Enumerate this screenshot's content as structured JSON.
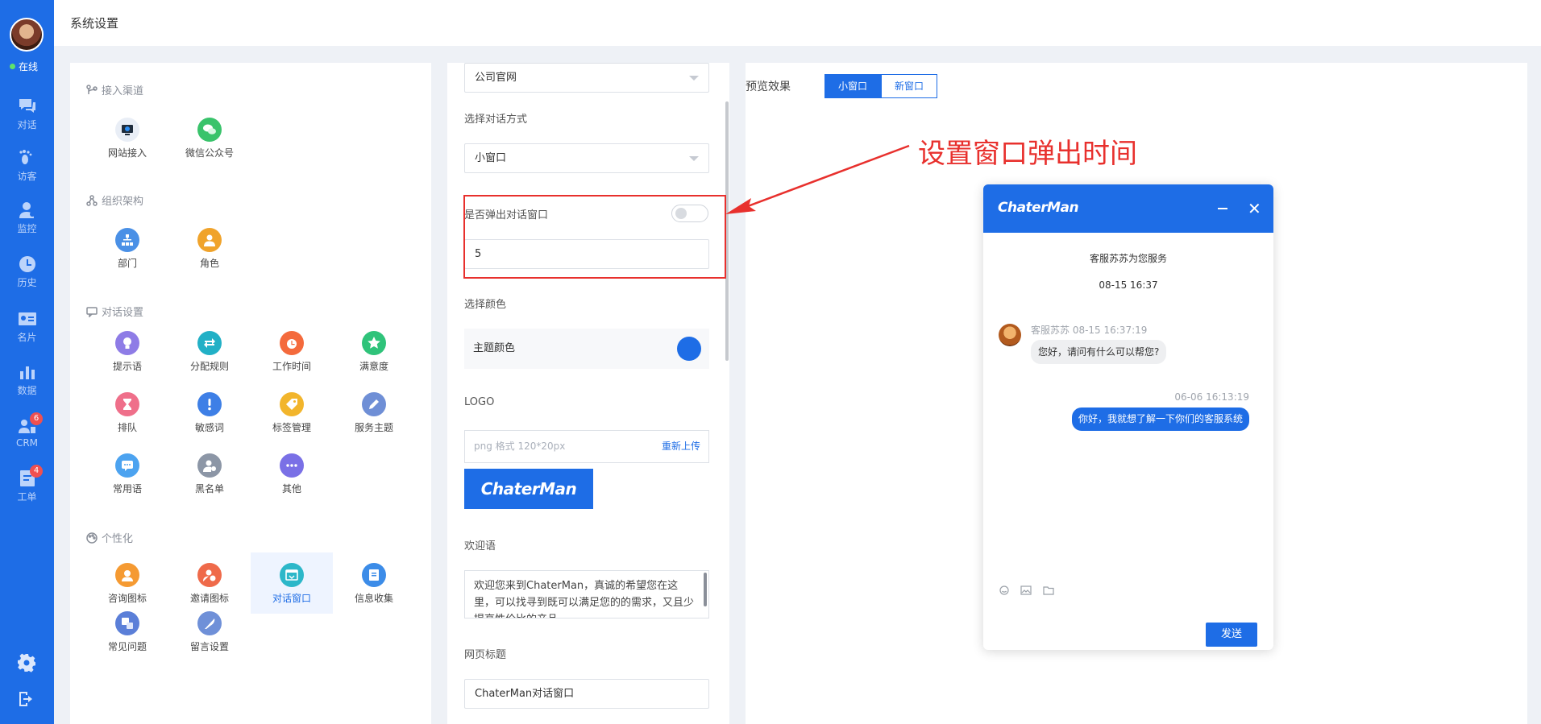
{
  "rail": {
    "status": "在线",
    "items": [
      {
        "label": "对话",
        "icon": "chat-icon"
      },
      {
        "label": "访客",
        "icon": "footprint-icon"
      },
      {
        "label": "监控",
        "icon": "monitor-user-icon"
      },
      {
        "label": "历史",
        "icon": "clock-icon"
      },
      {
        "label": "名片",
        "icon": "card-icon"
      },
      {
        "label": "数据",
        "icon": "bar-chart-icon"
      },
      {
        "label": "CRM",
        "icon": "crm-icon",
        "badge": "6"
      },
      {
        "label": "工单",
        "icon": "ticket-icon",
        "badge": "4"
      }
    ]
  },
  "header": {
    "title": "系统设置"
  },
  "menu": {
    "sections": [
      {
        "title": "接入渠道",
        "items": [
          "网站接入",
          "微信公众号"
        ]
      },
      {
        "title": "组织架构",
        "items": [
          "部门",
          "角色"
        ]
      },
      {
        "title": "对话设置",
        "items": [
          "提示语",
          "分配规则",
          "工作时间",
          "满意度",
          "排队",
          "敏感词",
          "标签管理",
          "服务主题",
          "常用语",
          "黑名单",
          "其他"
        ]
      },
      {
        "title": "个性化",
        "items": [
          "咨询图标",
          "邀请图标",
          "对话窗口",
          "信息收集",
          "常见问题",
          "留言设置"
        ]
      }
    ]
  },
  "form": {
    "channel_value": "公司官网",
    "mode_label": "选择对话方式",
    "mode_value": "小窗口",
    "popup_label": "是否弹出对话窗口",
    "popup_delay": "5",
    "color_label": "选择颜色",
    "theme_color_label": "主题颜色",
    "theme_color": "#1e6de6",
    "logo_label": "LOGO",
    "logo_placeholder": "png 格式 120*20px",
    "reupload": "重新上传",
    "logo_text": "ChaterMan",
    "welcome_label": "欢迎语",
    "welcome_text": "欢迎您来到ChaterMan，真诚的希望您在这里，可以找寻到既可以满足您的的需求，又且少提高性价比的产品。",
    "page_title_label": "网页标题",
    "page_title_value": "ChaterMan对话窗口"
  },
  "preview": {
    "label": "预览效果",
    "tab_small": "小窗口",
    "tab_new": "新窗口",
    "annotation": "设置窗口弹出时间"
  },
  "chat": {
    "logo": "ChaterMan",
    "service_line": "客服苏苏为您服务",
    "time_1": "08-15 16:37",
    "agent_meta": "客服苏苏 08-15 16:37:19",
    "agent_msg": "您好，请问有什么可以帮您?",
    "user_time": "06-06 16:13:19",
    "user_msg": "你好，我就想了解一下你们的客服系统",
    "send": "发送"
  }
}
